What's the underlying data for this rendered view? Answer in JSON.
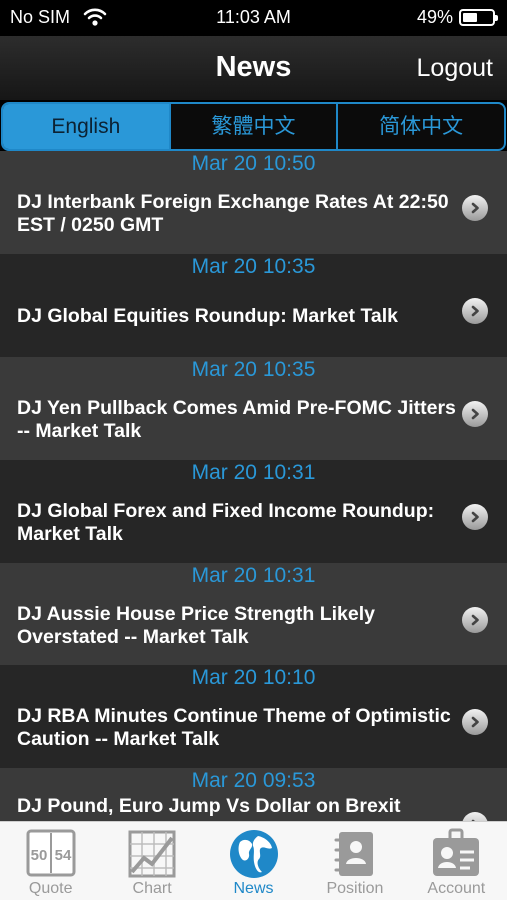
{
  "status_bar": {
    "carrier": "No SIM",
    "time": "11:03 AM",
    "battery_percent": "49%",
    "battery_level": 0.49
  },
  "nav_bar": {
    "title": "News",
    "logout_label": "Logout"
  },
  "language_tabs": [
    {
      "label": "English",
      "active": true
    },
    {
      "label": "繁體中文",
      "active": false
    },
    {
      "label": "简体中文",
      "active": false
    }
  ],
  "news": [
    {
      "date": "Mar 20 10:50",
      "headline": "DJ Interbank Foreign Exchange Rates At 22:50 EST / 0250 GMT"
    },
    {
      "date": "Mar 20 10:35",
      "headline": "DJ Global Equities Roundup: Market Talk"
    },
    {
      "date": "Mar 20 10:35",
      "headline": "DJ Yen Pullback Comes Amid Pre-FOMC Jitters -- Market Talk"
    },
    {
      "date": "Mar 20 10:31",
      "headline": "DJ Global Forex and Fixed Income Roundup: Market Talk"
    },
    {
      "date": "Mar 20 10:31",
      "headline": "DJ Aussie House Price Strength Likely Overstated -- Market Talk"
    },
    {
      "date": "Mar 20 10:10",
      "headline": "DJ RBA Minutes Continue Theme of Optimistic Caution -- Market Talk"
    },
    {
      "date": "Mar 20 09:53",
      "headline": "DJ Pound, Euro Jump Vs Dollar on Brexit"
    }
  ],
  "tab_bar": {
    "quote": {
      "label": "Quote",
      "icon": "quote-icon",
      "icon_text": "50 54"
    },
    "chart": {
      "label": "Chart",
      "icon": "chart-icon"
    },
    "news": {
      "label": "News",
      "icon": "globe-icon"
    },
    "position": {
      "label": "Position",
      "icon": "position-icon"
    },
    "account": {
      "label": "Account",
      "icon": "account-icon"
    }
  },
  "colors": {
    "accent": "#2a98d8",
    "row_light": "#3a3a3a",
    "row_dark": "#262626",
    "tab_inactive": "#9a9a9a"
  }
}
